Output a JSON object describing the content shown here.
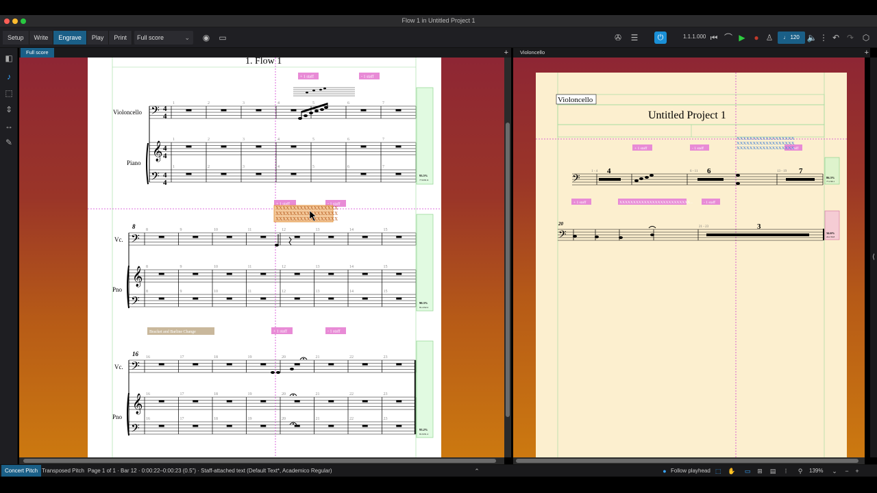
{
  "window": {
    "title": "Flow 1 in Untitled Project 1"
  },
  "toolbar": {
    "modes": [
      "Setup",
      "Write",
      "Engrave",
      "Play",
      "Print"
    ],
    "active_mode": "Engrave",
    "layout_select": "Full score",
    "timecode": "1.1.1.000",
    "tempo": "120",
    "accent_color": "#1a5f87"
  },
  "tabs": {
    "left": "Full score",
    "right": "Violoncello"
  },
  "score_left": {
    "flow_title": "1. Flow 1",
    "instruments_full": [
      "Violoncello",
      "Piano"
    ],
    "instruments_abbrev": [
      "Vc.",
      "Pno"
    ],
    "system1_bars": [
      "1",
      "2",
      "3",
      "4",
      "5",
      "6",
      "7"
    ],
    "system2_bars": [
      "8",
      "9",
      "10",
      "11",
      "12",
      "13",
      "14",
      "15"
    ],
    "system3_bars": [
      "16",
      "17",
      "18",
      "19",
      "20",
      "21",
      "22",
      "23"
    ],
    "system2_start": "8",
    "system3_start": "16",
    "staff_tags": [
      "+ 1 staff",
      "- 1 staff",
      "+ 1 staff",
      "- 1 staff",
      "+ 1 staff",
      "- 1 staff"
    ],
    "selected_text": [
      "XXXXXXXXXXXXXXXXXX",
      "XXXXXXXXXXXXXXXXXX",
      "XXXXXXXXXXXXXXXXXX"
    ],
    "bracket_change": "Bracket and Barline Change",
    "fill_stats": [
      "93.5%",
      "77.6/81.9",
      "90.3%",
      "81.2/92.2",
      "93.2%",
      "81.9/91.2"
    ]
  },
  "score_right": {
    "part_name": "Violoncello",
    "project_title": "Untitled Project 1",
    "rest_counts": [
      "4",
      "6",
      "7",
      "3"
    ],
    "bar_ranges": [
      "1 - 4",
      "6 - 11",
      "13 - 19",
      "21 - 23"
    ],
    "system2_start": "20",
    "staff_tags": [
      "+ 1 staff",
      "- 1 staff",
      "+ 1 staff",
      "+ 1 staff",
      "- 1 staff"
    ],
    "selected_text": [
      "XXXXXXXXXXXXXXXXXX",
      "XXXXXXXXXXXXXXXXXX",
      "XXXXXXXXXXXXXXXXXX"
    ],
    "long_text": "XXXXXXXXXXXXXXXXXXXXXXXXXX...",
    "fill_stats": [
      "86.3%",
      "77.1/90.1",
      "34.6%",
      "24.1/56.8"
    ]
  },
  "statusbar": {
    "concert_pitch": "Concert Pitch",
    "transposed_pitch": "Transposed Pitch",
    "info": "Page 1 of 1 · Bar 12 · 0:00:22–0:00:23 (0.5\") · Staff-attached text (Default Text*, Academico Regular)",
    "follow_playhead": "Follow playhead",
    "zoom": "139%"
  }
}
